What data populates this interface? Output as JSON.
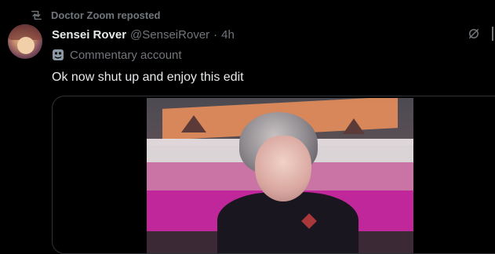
{
  "repost": {
    "icon": "repost-icon",
    "text": "Doctor Zoom reposted"
  },
  "tweet": {
    "avatar": "avatar",
    "author_name": "Sensei Rover",
    "handle": "@SenseiRover",
    "separator": "·",
    "time": "4h",
    "label_icon": "mask-icon",
    "label": "Commentary account",
    "text": "Ok now shut up and enjoy this edit",
    "media_type": "video"
  },
  "actions": {
    "grok_icon": "grok-icon"
  },
  "colors": {
    "background": "#000000",
    "primary_text": "#e7e9ea",
    "secondary_text": "#71767b",
    "border": "#2f3336"
  }
}
